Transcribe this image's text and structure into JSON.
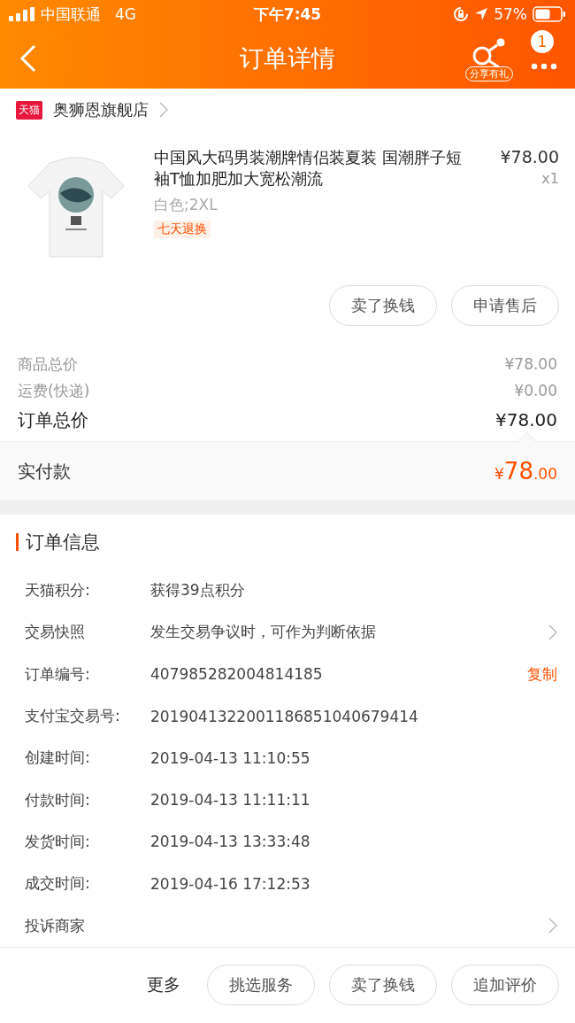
{
  "status_bar": {
    "carrier": "中国联通",
    "network": "4G",
    "time": "下午7:45",
    "battery": "57%"
  },
  "nav": {
    "title": "订单详情",
    "share_label": "分享有礼",
    "badge": "1"
  },
  "shop": {
    "badge": "天猫",
    "name": "奥狮恩旗舰店"
  },
  "product": {
    "title": "中国风大码男装潮牌情侣装夏装 国潮胖子短袖T恤加肥加大宽松潮流",
    "price": "¥78.00",
    "quantity": "x1",
    "sku": "白色;2XL",
    "tag": "七天退换"
  },
  "item_actions": [
    "卖了换钱",
    "申请售后"
  ],
  "summary": [
    {
      "label": "商品总价",
      "value": "¥78.00",
      "kind": "minor"
    },
    {
      "label": "运费(快递)",
      "value": "¥0.00",
      "kind": "minor"
    },
    {
      "label": "订单总价",
      "value": "¥78.00",
      "kind": "major"
    }
  ],
  "paid": {
    "label": "实付款",
    "currency": "¥",
    "integer": "78",
    "decimal": ".00"
  },
  "order_info": {
    "title": "订单信息",
    "rows": [
      {
        "label": "天猫积分:",
        "value": "获得39点积分",
        "kind": "text"
      },
      {
        "label": "交易快照",
        "value": "发生交易争议时，可作为判断依据",
        "kind": "link"
      },
      {
        "label": "订单编号:",
        "value": "407985282004814185",
        "kind": "copy",
        "action": "复制"
      },
      {
        "label": "支付宝交易号:",
        "value": "2019041322001186851040679414",
        "kind": "text"
      },
      {
        "label": "创建时间:",
        "value": "2019-04-13 11:10:55",
        "kind": "text"
      },
      {
        "label": "付款时间:",
        "value": "2019-04-13 11:11:11",
        "kind": "text"
      },
      {
        "label": "发货时间:",
        "value": "2019-04-13 13:33:48",
        "kind": "text"
      },
      {
        "label": "成交时间:",
        "value": "2019-04-16 17:12:53",
        "kind": "text"
      },
      {
        "label": "投诉商家",
        "kind": "link"
      }
    ]
  },
  "bottom_bar": {
    "more": "更多",
    "buttons": [
      "挑选服务",
      "卖了换钱",
      "追加评价"
    ]
  }
}
